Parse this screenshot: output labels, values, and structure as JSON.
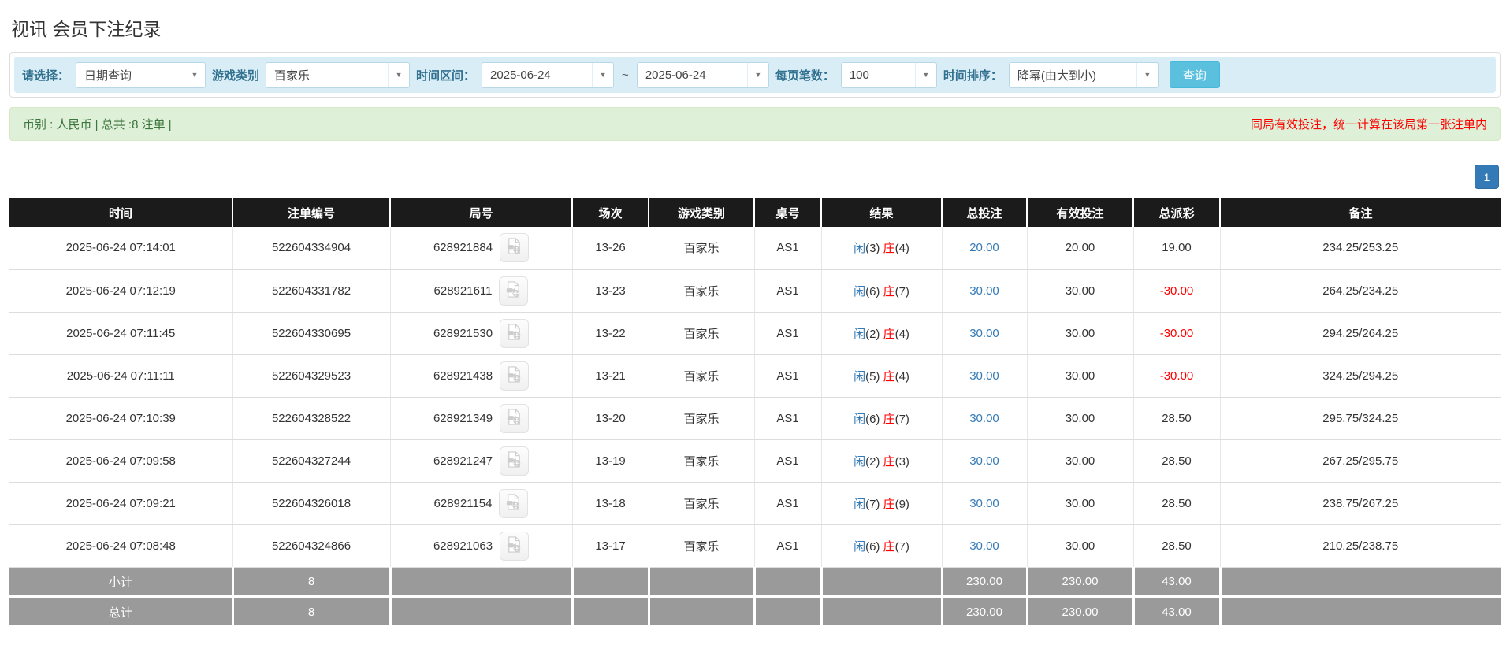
{
  "page_title": "视讯 会员下注纪录",
  "filter_bar": {
    "select_label": "请选择：",
    "select_value": "日期查询",
    "game_type_label": "游戏类别",
    "game_type_value": "百家乐",
    "time_range_label": "时间区间：",
    "time_from": "2025-06-24",
    "time_separator": "~",
    "time_to": "2025-06-24",
    "page_size_label": "每页笔数：",
    "page_size_value": "100",
    "sort_label": "时间排序：",
    "sort_value": "降幂(由大到小)",
    "query_button": "查询"
  },
  "summary_bar": {
    "left_text": "币别 : 人民币 | 总共 :8 注单 |",
    "right_text": "同局有效投注，统一计算在该局第一张注单内"
  },
  "pagination": {
    "pages": [
      "1"
    ]
  },
  "colors": {
    "accent_blue": "#337ab7",
    "query_button_blue": "#5bc0de",
    "red": "#ff0000",
    "green_text": "#3c763d",
    "green_bg": "#dff0d8",
    "filter_bg": "#d9edf7",
    "filter_label": "#31708f",
    "header_bg": "#1b1b1b",
    "footer_bg": "#9a9a9a"
  },
  "table": {
    "headers": [
      "时间",
      "注单编号",
      "局号",
      "场次",
      "游戏类别",
      "桌号",
      "结果",
      "总投注",
      "有效投注",
      "总派彩",
      "备注"
    ],
    "result_labels": {
      "player": "闲",
      "banker": "庄"
    },
    "video_icon_name": "video-file-icon",
    "rows": [
      {
        "time": "2025-06-24 07:14:01",
        "bet_id": "522604334904",
        "round_id": "628921884",
        "session": "13-26",
        "game_type": "百家乐",
        "table_no": "AS1",
        "result": {
          "player": "3",
          "banker": "4"
        },
        "total_bet": "20.00",
        "valid_bet": "20.00",
        "payout": "19.00",
        "remark": "234.25/253.25"
      },
      {
        "time": "2025-06-24 07:12:19",
        "bet_id": "522604331782",
        "round_id": "628921611",
        "session": "13-23",
        "game_type": "百家乐",
        "table_no": "AS1",
        "result": {
          "player": "6",
          "banker": "7"
        },
        "total_bet": "30.00",
        "valid_bet": "30.00",
        "payout": "-30.00",
        "remark": "264.25/234.25"
      },
      {
        "time": "2025-06-24 07:11:45",
        "bet_id": "522604330695",
        "round_id": "628921530",
        "session": "13-22",
        "game_type": "百家乐",
        "table_no": "AS1",
        "result": {
          "player": "2",
          "banker": "4"
        },
        "total_bet": "30.00",
        "valid_bet": "30.00",
        "payout": "-30.00",
        "remark": "294.25/264.25"
      },
      {
        "time": "2025-06-24 07:11:11",
        "bet_id": "522604329523",
        "round_id": "628921438",
        "session": "13-21",
        "game_type": "百家乐",
        "table_no": "AS1",
        "result": {
          "player": "5",
          "banker": "4"
        },
        "total_bet": "30.00",
        "valid_bet": "30.00",
        "payout": "-30.00",
        "remark": "324.25/294.25"
      },
      {
        "time": "2025-06-24 07:10:39",
        "bet_id": "522604328522",
        "round_id": "628921349",
        "session": "13-20",
        "game_type": "百家乐",
        "table_no": "AS1",
        "result": {
          "player": "6",
          "banker": "7"
        },
        "total_bet": "30.00",
        "valid_bet": "30.00",
        "payout": "28.50",
        "remark": "295.75/324.25"
      },
      {
        "time": "2025-06-24 07:09:58",
        "bet_id": "522604327244",
        "round_id": "628921247",
        "session": "13-19",
        "game_type": "百家乐",
        "table_no": "AS1",
        "result": {
          "player": "2",
          "banker": "3"
        },
        "total_bet": "30.00",
        "valid_bet": "30.00",
        "payout": "28.50",
        "remark": "267.25/295.75"
      },
      {
        "time": "2025-06-24 07:09:21",
        "bet_id": "522604326018",
        "round_id": "628921154",
        "session": "13-18",
        "game_type": "百家乐",
        "table_no": "AS1",
        "result": {
          "player": "7",
          "banker": "9"
        },
        "total_bet": "30.00",
        "valid_bet": "30.00",
        "payout": "28.50",
        "remark": "238.75/267.25"
      },
      {
        "time": "2025-06-24 07:08:48",
        "bet_id": "522604324866",
        "round_id": "628921063",
        "session": "13-17",
        "game_type": "百家乐",
        "table_no": "AS1",
        "result": {
          "player": "6",
          "banker": "7"
        },
        "total_bet": "30.00",
        "valid_bet": "30.00",
        "payout": "28.50",
        "remark": "210.25/238.75"
      }
    ],
    "footer": [
      {
        "label": "小计",
        "count": "8",
        "total_bet": "230.00",
        "valid_bet": "230.00",
        "payout": "43.00"
      },
      {
        "label": "总计",
        "count": "8",
        "total_bet": "230.00",
        "valid_bet": "230.00",
        "payout": "43.00"
      }
    ]
  }
}
